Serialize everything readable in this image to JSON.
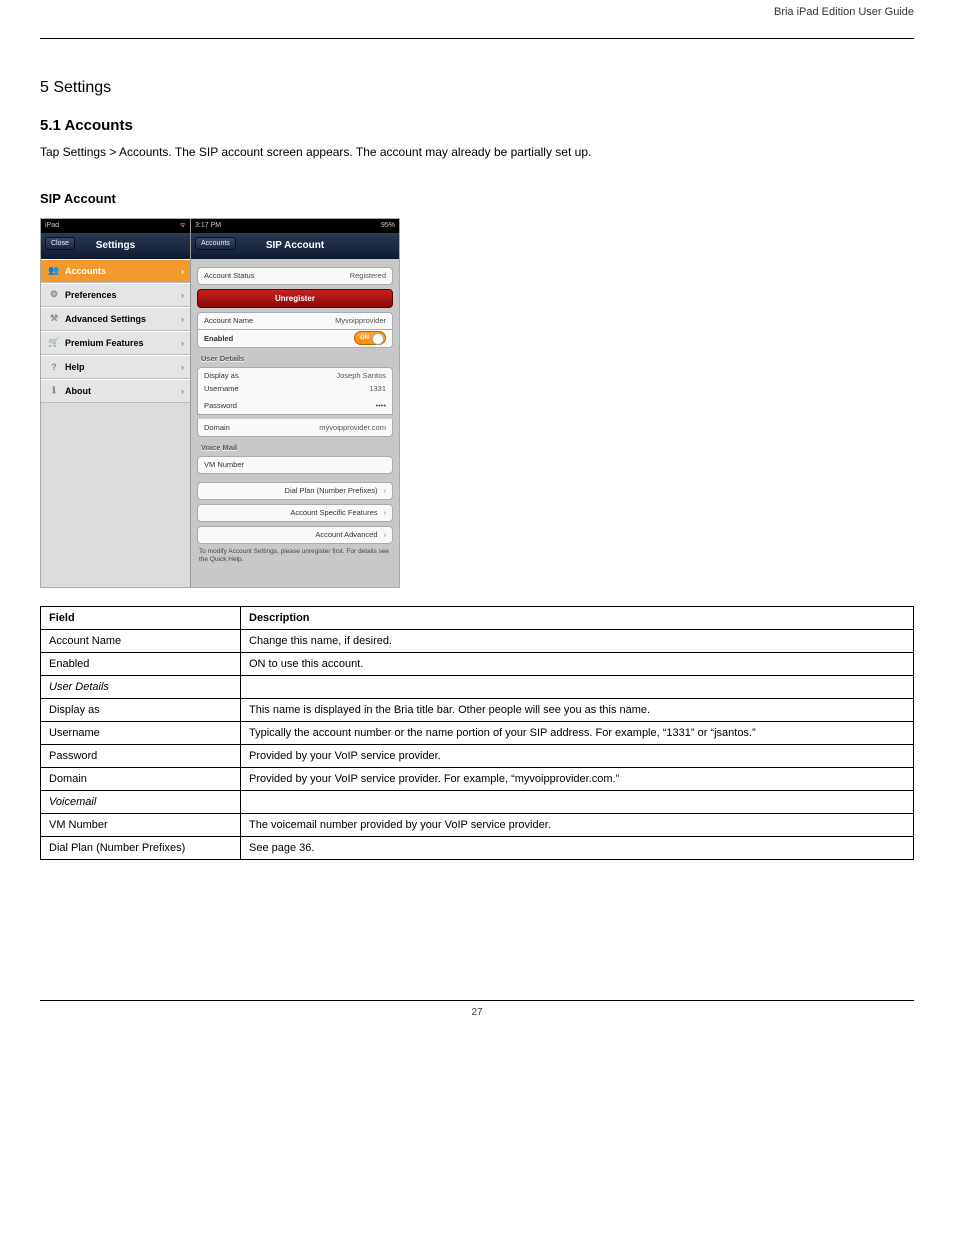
{
  "header": {
    "doc_title": "Bria iPad Edition User Guide",
    "section_num_line": "5   Settings",
    "section_title": "5.1 Accounts",
    "intro": "Tap Settings > Accounts. The SIP account screen appears. The account may already be partially set up.",
    "sub_heading": "SIP Account"
  },
  "screenshot": {
    "statusbar_left": "iPad",
    "statusbar_time": "3:17 PM",
    "statusbar_batt": "95%",
    "left_header": "Settings",
    "close_btn": "Close",
    "side_items": [
      {
        "label": "Accounts",
        "icon": "👥",
        "active": true
      },
      {
        "label": "Preferences",
        "icon": "⚙",
        "active": false
      },
      {
        "label": "Advanced Settings",
        "icon": "⚒",
        "active": false
      },
      {
        "label": "Premium Features",
        "icon": "🛒",
        "active": false
      },
      {
        "label": "Help",
        "icon": "?",
        "active": false
      },
      {
        "label": "About",
        "icon": "ℹ",
        "active": false
      }
    ],
    "right_header": "SIP Account",
    "back_btn": "Accounts",
    "account_status_label": "Account Status",
    "account_status_value": "Registered",
    "unregister_btn": "Unregister",
    "account_name_label": "Account Name",
    "account_name_value": "Myvoipprovider",
    "enabled_label": "Enabled",
    "toggle_on": "ON",
    "user_details_header": "User Details",
    "display_as_label": "Display as",
    "display_as_value": "Joseph Santos",
    "username_label": "Username",
    "username_value": "1331",
    "password_label": "Password",
    "password_value": "••••",
    "domain_label": "Domain",
    "domain_value": "myvoipprovider.com",
    "voicemail_header": "Voice Mail",
    "vm_number_label": "VM Number",
    "vm_number_value": "",
    "link_dialplan": "Dial Plan (Number Prefixes)",
    "link_features": "Account Specific Features",
    "link_advanced": "Account Advanced",
    "foot_note": "To modify Account Settings, please unregister first. For details see the Quick Help."
  },
  "table": {
    "head_field": "Field",
    "head_desc": "Description",
    "rows": [
      {
        "f": "Account Name",
        "d": "Change this name, if desired."
      },
      {
        "f": "Enabled",
        "d": "ON to use this account."
      },
      {
        "f": "User Details",
        "d": ""
      },
      {
        "f": "Display as",
        "d": "This name is displayed in the Bria title bar. Other people will see you as this name."
      },
      {
        "f": "Username",
        "d": "Typically the account number or the name portion of your SIP address. For example, “1331” or “jsantos.”"
      },
      {
        "f": "Password",
        "d": "Provided by your VoIP service provider."
      },
      {
        "f": "Domain",
        "d": "Provided by your VoIP service provider. For example, “myvoipprovider.com.”"
      },
      {
        "f": "Voicemail",
        "d": ""
      },
      {
        "f": "VM Number",
        "d": "The voicemail number provided by your VoIP service provider."
      },
      {
        "f": "Dial Plan (Number Prefixes)",
        "d": "See page 36."
      }
    ]
  },
  "footer": {
    "page": "27"
  }
}
